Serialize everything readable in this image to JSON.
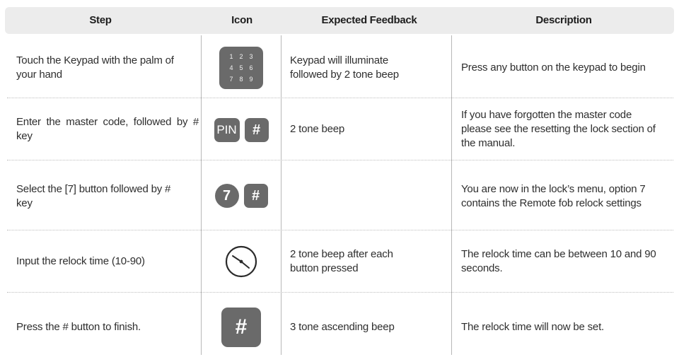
{
  "header": {
    "step": "Step",
    "icon": "Icon",
    "feedback": "Expected Feedback",
    "description": "Description"
  },
  "rows": [
    {
      "step": "Touch the Keypad with the palm of your hand",
      "icon": "keypad-icon",
      "keypad_digits": [
        "1",
        "2",
        "3",
        "4",
        "5",
        "6",
        "7",
        "8",
        "9"
      ],
      "feedback": "Keypad will illuminate followed by 2 tone beep",
      "description": "Press any button on the keypad to begin"
    },
    {
      "step": "Enter the master code, followed by # key",
      "icon": "pin-and-hash-icons",
      "pin_label": "PIN",
      "hash_label": "#",
      "feedback": "2 tone beep",
      "description": "If you have forgotten the master code please see the resetting the lock section of the manual."
    },
    {
      "step": "Select the [7] button followed by # key",
      "icon": "seven-and-hash-icons",
      "seven_label": "7",
      "hash_label": "#",
      "feedback": "",
      "description": "You are now in the lock’s menu, option 7 contains the Remote fob  relock settings"
    },
    {
      "step": "Input the relock time (10-90)",
      "icon": "clock-icon",
      "feedback": "2 tone beep after each button pressed",
      "description": "The relock time can be between 10 and 90 seconds."
    },
    {
      "step": "Press the # button to finish.",
      "icon": "hash-icon",
      "hash_label": "#",
      "feedback": "3 tone ascending beep",
      "description": "The relock time will now be set."
    }
  ],
  "colors": {
    "header_bg": "#ececec",
    "icon_fill": "#6a6a6a",
    "text": "#2e2e2e"
  }
}
